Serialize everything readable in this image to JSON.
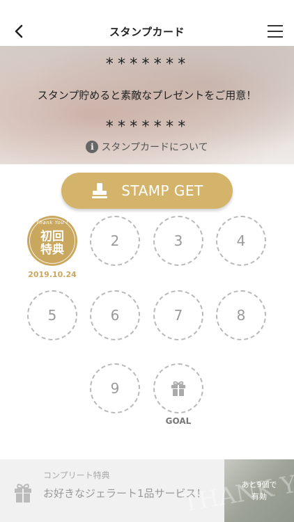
{
  "nav": {
    "title": "スタンプカード",
    "back_icon": "chevron-left-icon",
    "menu_icon": "hamburger-menu-icon"
  },
  "hero": {
    "stars_top": "*******",
    "message": "スタンプ貯めると素敵なプレゼントをご用意！",
    "stars_bottom": "*******",
    "info_icon_glyph": "i",
    "info_link": "スタンプカードについて"
  },
  "stamp_button": {
    "label": "STAMP GET",
    "icon": "stamp-icon",
    "color": "#d4b36b"
  },
  "stamps": {
    "first": {
      "thanks": "Thank You !",
      "line1": "初回",
      "line2": "特典",
      "date": "2019.10.24"
    },
    "slots": [
      "2",
      "3",
      "4",
      "5",
      "6",
      "7",
      "8",
      "9"
    ],
    "goal_label": "GOAL",
    "goal_icon": "gift-icon"
  },
  "complete": {
    "label": "コンプリート特典",
    "text": "お好きなジェラート1品サービス！",
    "badge_line1": "あと9個で",
    "badge_line2": "有効",
    "badge_bg_word": "THANK YOU",
    "icon": "gift-icon"
  },
  "colors": {
    "gold": "#c9a75f",
    "button_gold": "#d4b36b",
    "dashed_border": "#b9b9b9"
  }
}
